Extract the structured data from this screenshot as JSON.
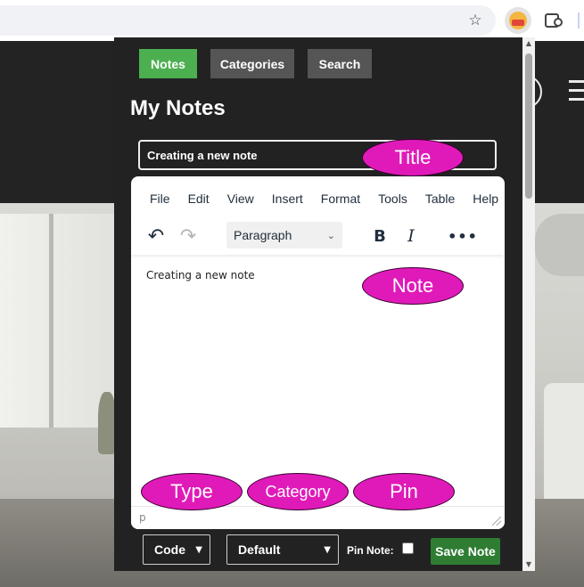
{
  "browser": {
    "icons": {
      "bookmark": "star-icon",
      "extension": "extension-avatar-icon",
      "extensions_menu": "puzzle-icon"
    }
  },
  "popup": {
    "nav": {
      "notes": "Notes",
      "categories": "Categories",
      "search": "Search"
    },
    "heading": "My Notes",
    "title_input": {
      "value": "Creating a new note"
    },
    "editor": {
      "menu": [
        "File",
        "Edit",
        "View",
        "Insert",
        "Format",
        "Tools",
        "Table",
        "Help"
      ],
      "block_format": "Paragraph",
      "toolbar_icons": [
        "undo-icon",
        "redo-icon",
        "bold-icon",
        "italic-icon",
        "more-icon"
      ],
      "bold_glyph": "B",
      "italic_glyph": "I",
      "content": "Creating a new note",
      "status_path": "p"
    },
    "footer": {
      "type_select": "Code",
      "category_select": "Default",
      "pin_label": "Pin Note:",
      "pin_checked": false,
      "save_label": "Save Note"
    }
  },
  "callouts": {
    "title": "Title",
    "note": "Note",
    "type": "Type",
    "category": "Category",
    "pin": "Pin"
  },
  "colors": {
    "notes_tab": "#4caf50",
    "nav_tab": "#555555",
    "popup_bg": "#222222",
    "save_button": "#2e7d32",
    "callout": "#e01ab9"
  }
}
